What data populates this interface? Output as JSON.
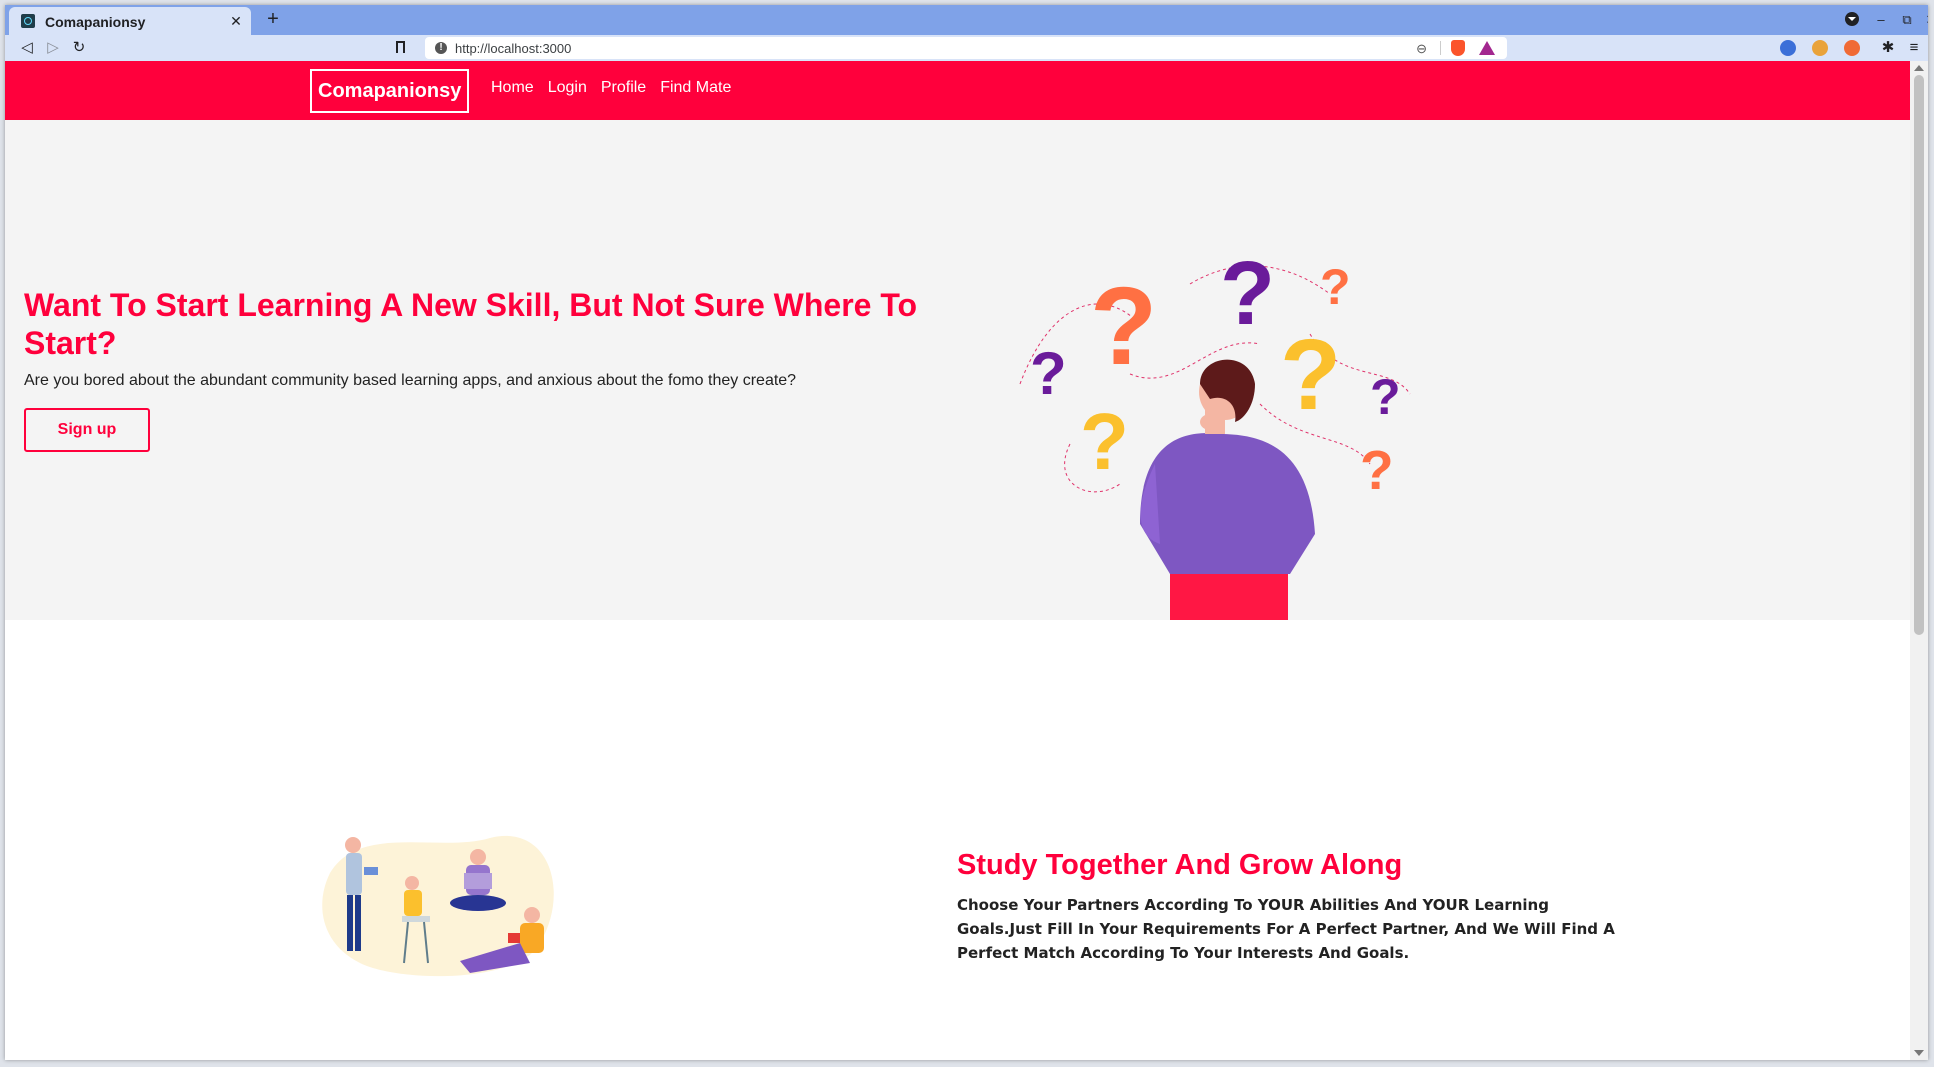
{
  "browser": {
    "tab_title": "Comapanionsy",
    "tab_close": "✕",
    "new_tab": "+",
    "url": "http://localhost:3000",
    "window_controls": [
      "–",
      "⧉",
      "✕"
    ]
  },
  "navbar": {
    "brand": "Comapanionsy",
    "links": [
      "Home",
      "Login",
      "Profile",
      "Find Mate"
    ]
  },
  "hero": {
    "title": "Want To Start Learning A New Skill, But Not Sure Where To Start?",
    "subtitle": "Are you bored about the abundant community based learning apps, and anxious about the fomo they create?",
    "cta": "Sign up",
    "illustration": "person-with-question-marks"
  },
  "study": {
    "title": "Study Together And Grow Along",
    "description": "Choose Your Partners According To YOUR Abilities And YOUR Learning Goals.Just Fill In Your Requirements For A Perfect Partner, And We Will Find A Perfect Match According To Your Interests And Goals.",
    "illustration": "group-studying"
  },
  "colors": {
    "accent": "#ff003c",
    "hero_bg": "#f4f4f4",
    "tab_strip": "#7fa2e8",
    "toolbar": "#d8e3f8"
  }
}
